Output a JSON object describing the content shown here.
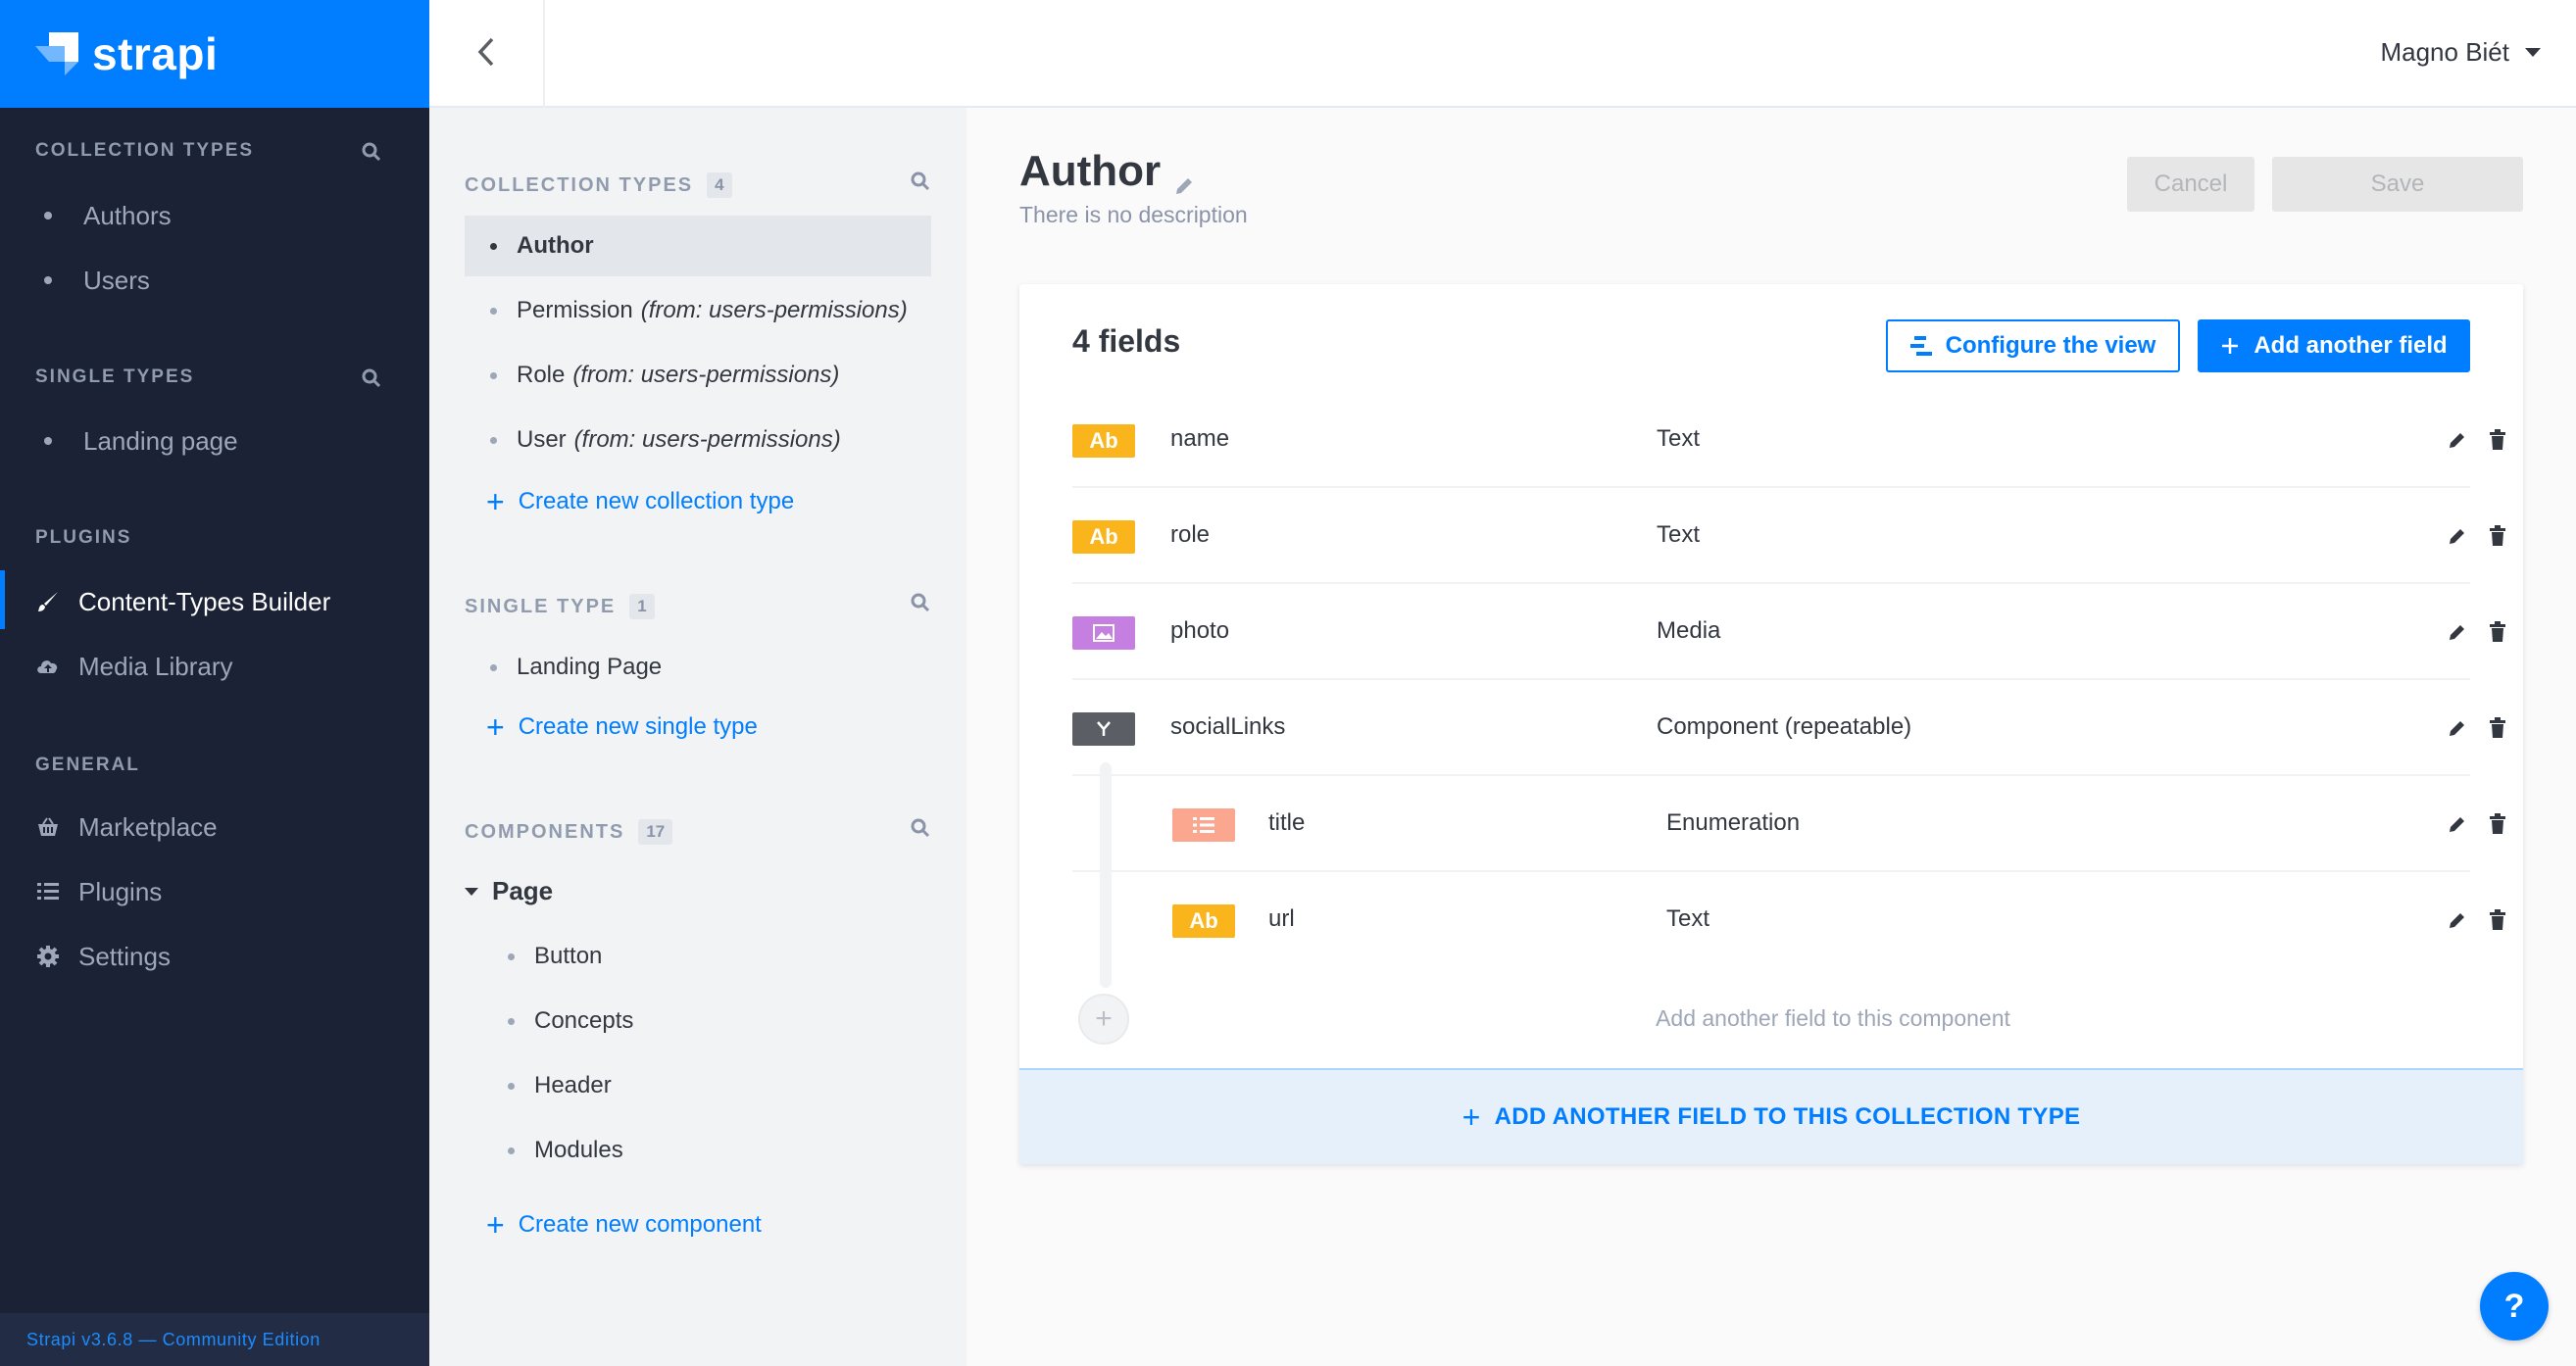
{
  "brand": {
    "name": "strapi"
  },
  "leftnav": {
    "collection_types_label": "Collection Types",
    "collection_types": [
      "Authors",
      "Users"
    ],
    "single_types_label": "Single Types",
    "single_types": [
      "Landing page"
    ],
    "plugins_label": "Plugins",
    "plugins": [
      {
        "label": "Content-Types Builder",
        "icon": "brush-icon"
      },
      {
        "label": "Media Library",
        "icon": "cloud-upload-icon"
      }
    ],
    "general_label": "General",
    "general": [
      {
        "label": "Marketplace",
        "icon": "basket-icon"
      },
      {
        "label": "Plugins",
        "icon": "list-icon"
      },
      {
        "label": "Settings",
        "icon": "gear-icon"
      }
    ],
    "version": "Strapi v3.6.8 — Community Edition"
  },
  "topbar": {
    "user": "Magno Biét"
  },
  "subnav": {
    "collection_types_label": "COLLECTION TYPES",
    "collection_types_count": "4",
    "collection_types": [
      {
        "label": "Author",
        "from": ""
      },
      {
        "label": "Permission",
        "from": "(from: users-permissions)"
      },
      {
        "label": "Role",
        "from": "(from: users-permissions)"
      },
      {
        "label": "User",
        "from": "(from: users-permissions)"
      }
    ],
    "create_collection": "Create new collection type",
    "single_type_label": "SINGLE TYPE",
    "single_type_count": "1",
    "single_types": [
      "Landing Page"
    ],
    "create_single": "Create new single type",
    "components_label": "COMPONENTS",
    "components_count": "17",
    "component_group": "Page",
    "components": [
      "Button",
      "Concepts",
      "Header",
      "Modules"
    ],
    "create_component": "Create new component"
  },
  "main": {
    "title": "Author",
    "description": "There is no description",
    "cancel": "Cancel",
    "save": "Save",
    "fields_count": "4 fields",
    "configure_view": "Configure the view",
    "add_field": "Add another field",
    "fields": [
      {
        "name": "name",
        "type": "Text",
        "icon_label": "Ab",
        "color": "#fab41c"
      },
      {
        "name": "role",
        "type": "Text",
        "icon_label": "Ab",
        "color": "#fab41c"
      },
      {
        "name": "photo",
        "type": "Media",
        "icon_label": "",
        "color": "#c57fe0"
      },
      {
        "name": "socialLinks",
        "type": "Component (repeatable)",
        "icon_label": "",
        "color": "#5b5f65"
      }
    ],
    "component_fields": [
      {
        "name": "title",
        "type": "Enumeration",
        "icon_label": "",
        "color": "#fba68e"
      },
      {
        "name": "url",
        "type": "Text",
        "icon_label": "Ab",
        "color": "#fab41c"
      }
    ],
    "add_component_field": "Add another field to this component",
    "add_collection_field": "ADD ANOTHER FIELD TO THIS COLLECTION TYPE"
  },
  "help": "?"
}
